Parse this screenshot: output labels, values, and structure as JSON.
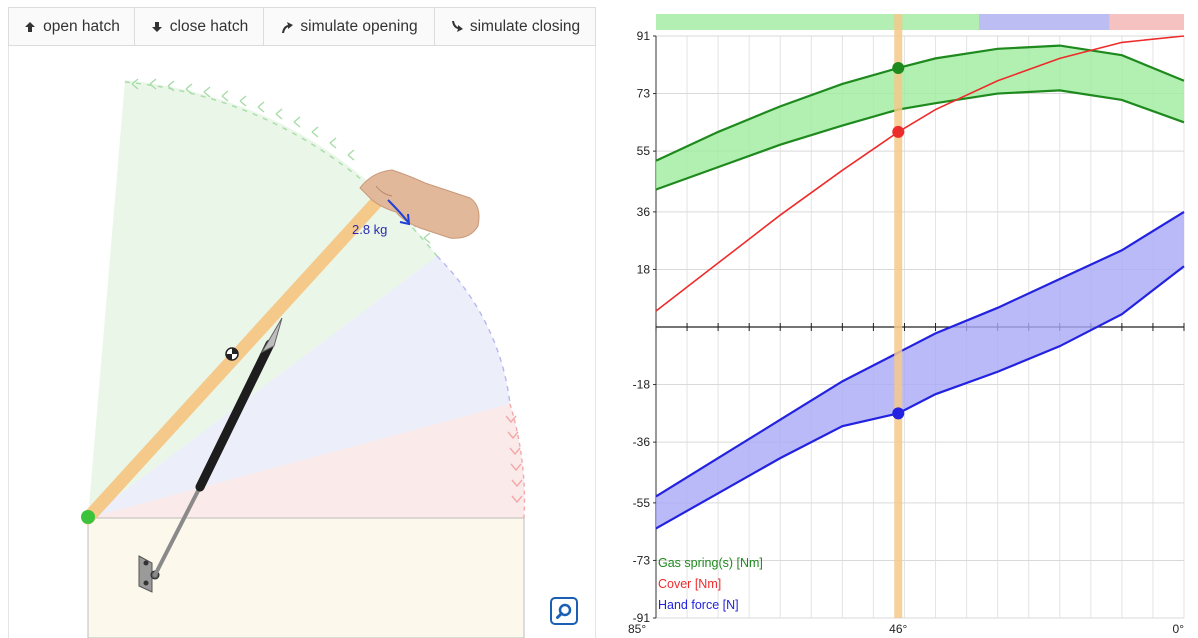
{
  "toolbar": {
    "open_hatch": "open hatch",
    "close_hatch": "close hatch",
    "simulate_opening": "simulate opening",
    "simulate_closing": "simulate closing",
    "icons": [
      "arrow-up-icon",
      "arrow-down-icon",
      "arrow-curve-up-icon",
      "arrow-curve-down-icon"
    ]
  },
  "simulation": {
    "mass_label": "2.8 kg",
    "zoom_icon": "zoom-icon",
    "colors": {
      "lid": "#f4c98a",
      "strut": "#222222",
      "pivot": "#3cc33c",
      "open_zone": "#eaf7e8",
      "mid_zone": "#eceefa",
      "closed_zone": "#fbeaea",
      "box": "#fdf8ec",
      "force_arrow": "#1f3fd8"
    }
  },
  "chart_data": {
    "type": "line",
    "x_ticks": [
      "85°",
      "46°",
      "0°"
    ],
    "y_ticks": [
      91,
      73,
      55,
      36,
      18,
      -18,
      -36,
      -55,
      -73,
      -91
    ],
    "ylim": [
      -91,
      91
    ],
    "xlim": [
      85,
      0
    ],
    "current_angle": 46,
    "top_band": [
      {
        "from": 85,
        "to": 33,
        "color": "#b3efb3"
      },
      {
        "from": 33,
        "to": 12,
        "color": "#bcbef3"
      },
      {
        "from": 12,
        "to": 0,
        "color": "#f6c1c1"
      }
    ],
    "series": [
      {
        "name": "Gas spring(s) [Nm]",
        "color": "#1e8a1e",
        "fill": "#9fec9f",
        "x": [
          85,
          75,
          65,
          55,
          46,
          40,
          30,
          20,
          10,
          0
        ],
        "upper": [
          52,
          61,
          69,
          76,
          81,
          84,
          87,
          88,
          85,
          77
        ],
        "lower": [
          43,
          50,
          57,
          63,
          68,
          70,
          73,
          74,
          71,
          64
        ]
      },
      {
        "name": "Cover [Nm]",
        "color": "#ee2b2b",
        "x": [
          85,
          75,
          65,
          55,
          46,
          40,
          30,
          20,
          10,
          0
        ],
        "y": [
          5,
          20,
          35,
          49,
          61,
          68,
          77,
          84,
          89,
          91
        ]
      },
      {
        "name": "Hand force [N]",
        "color": "#2222e0",
        "fill": "#a9a9f6",
        "x": [
          85,
          75,
          65,
          55,
          46,
          40,
          30,
          20,
          10,
          0
        ],
        "upper": [
          -53,
          -41,
          -29,
          -17,
          -8,
          -2,
          6,
          15,
          24,
          36
        ],
        "lower": [
          -63,
          -52,
          -41,
          -31,
          -27,
          -21,
          -14,
          -6,
          4,
          19
        ]
      }
    ],
    "markers": [
      {
        "series": "Gas spring(s) [Nm]",
        "y": 81
      },
      {
        "series": "Cover [Nm]",
        "y": 61
      },
      {
        "series": "Hand force [N]",
        "y": -27
      }
    ]
  }
}
